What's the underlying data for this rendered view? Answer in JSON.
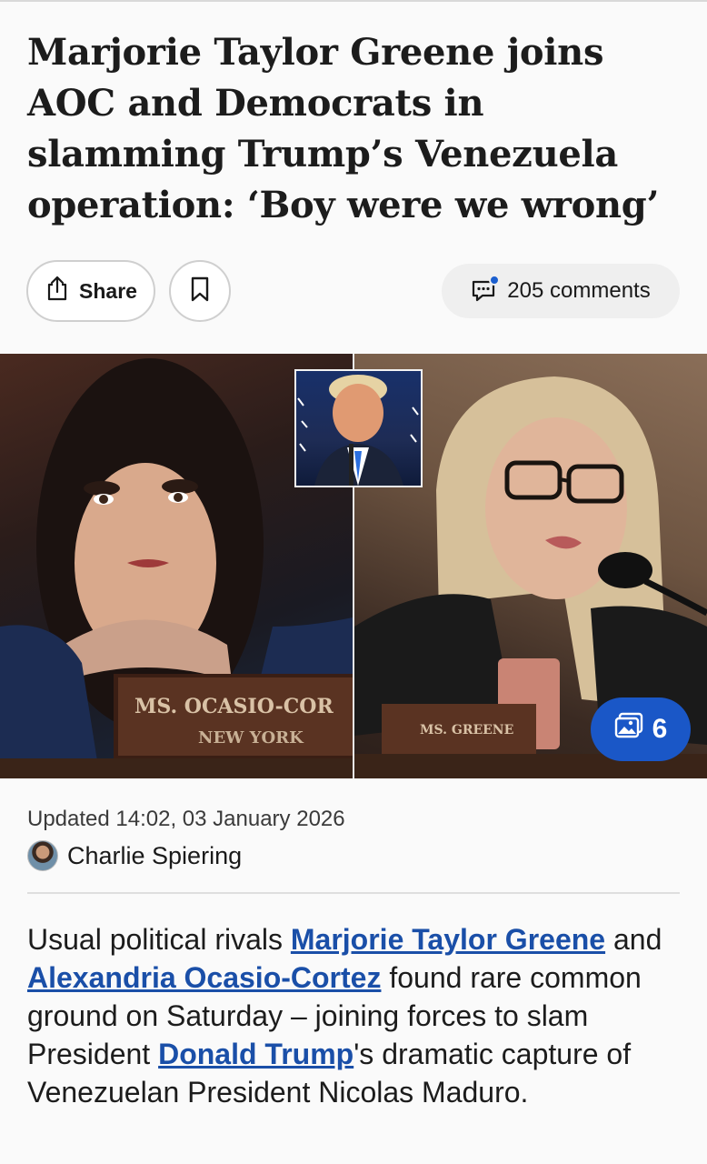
{
  "article": {
    "headline": "Marjorie Taylor Greene joins AOC and Democrats in slamming Trump’s Venezuela operation: ‘Boy were we wrong’",
    "updated": "Updated 14:02, 03 January 2026",
    "author": "Charlie Spiering"
  },
  "actions": {
    "share_label": "Share",
    "comments_label": "205 comments"
  },
  "hero": {
    "gallery_count": "6",
    "left_nameplate_line1": "MS. OCASIO-COR",
    "left_nameplate_line2": "NEW YORK",
    "right_nameplate": "MS. GREENE"
  },
  "body": {
    "t1": "Usual political rivals ",
    "link1": "Marjorie Taylor Greene",
    "t2": " and ",
    "link2": "Alexandria Ocasio-Cortez",
    "t3": " found rare common ground on Saturday – joining forces to slam President ",
    "link3": "Donald Trump",
    "t4": "'s dramatic capture of Venezuelan President Nicolas Maduro."
  },
  "colors": {
    "link": "#1a4fa8",
    "badge": "#1a57c7",
    "notification_dot": "#1b5fcf"
  },
  "icons": [
    "share-icon",
    "bookmark-icon",
    "comments-icon",
    "gallery-icon"
  ]
}
